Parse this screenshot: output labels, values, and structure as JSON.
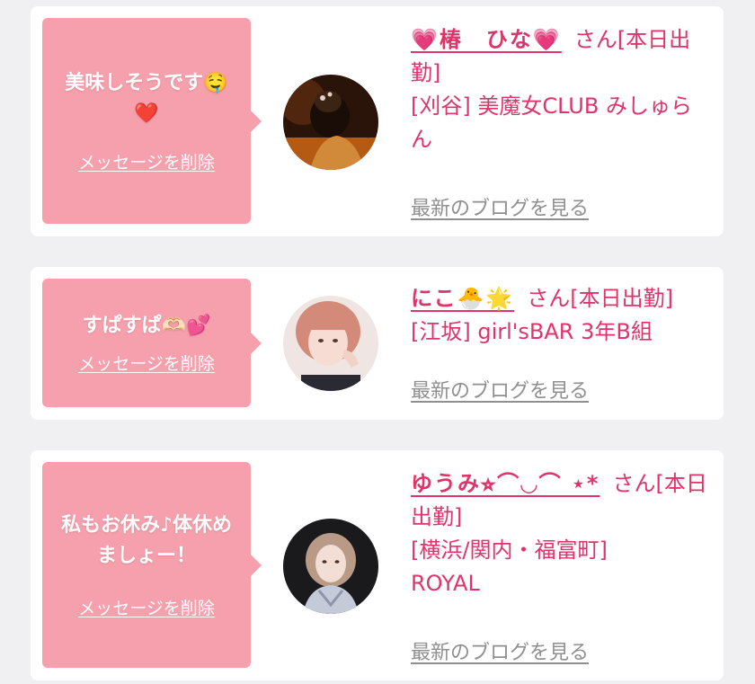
{
  "items": [
    {
      "message_line1": "美味しそうです🤤",
      "message_line2": "❤️",
      "delete_label": "メッセージを削除",
      "name": "💗椿　ひな💗",
      "honorific": "さん",
      "status": "[本日出勤]",
      "shop": "[刈谷] 美魔女CLUB みしゅらん",
      "blog_label": "最新のブログを見る"
    },
    {
      "message_line1": "すぱすぱ🫶🏻💕",
      "message_line2": "",
      "delete_label": "メッセージを削除",
      "name": "にこ🐣🌟",
      "honorific": "さん",
      "status": "[本日出勤]",
      "shop": "[江坂] girl'sBAR 3年B組",
      "blog_label": "最新のブログを見る"
    },
    {
      "message_line1": "私もお休み♪体休めましょー！",
      "message_line2": "",
      "delete_label": "メッセージを削除",
      "name": "ゆうみ⭐︎⌒◡⌒ ⋆*",
      "honorific": "さん",
      "status": "[本日出勤]",
      "shop": "[横浜/関内・福富町] ROYAL",
      "blog_label": "最新のブログを見る"
    }
  ],
  "colors": {
    "accent": "#e0336a",
    "bubble": "#f7a0ad",
    "link_gray": "#8f8f8f",
    "background": "#f0f0f2"
  }
}
